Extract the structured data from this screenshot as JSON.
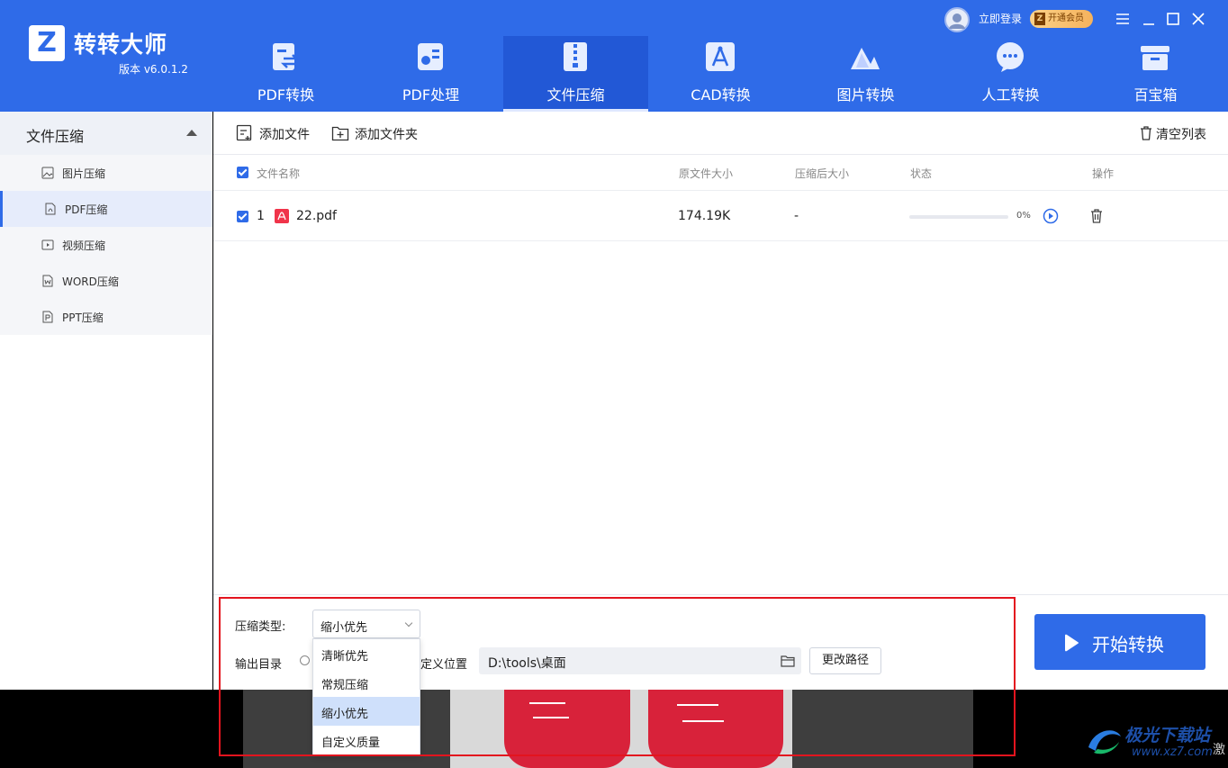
{
  "app": {
    "name": "转转大师",
    "version": "版本 v6.0.1.2",
    "logo_letter": "Z"
  },
  "nav": {
    "tabs": [
      {
        "label": "PDF转换",
        "icon": "pdf-convert-icon"
      },
      {
        "label": "PDF处理",
        "icon": "pdf-process-icon"
      },
      {
        "label": "文件压缩",
        "icon": "file-compress-icon",
        "active": true
      },
      {
        "label": "CAD转换",
        "icon": "cad-icon"
      },
      {
        "label": "图片转换",
        "icon": "image-convert-icon"
      },
      {
        "label": "人工转换",
        "icon": "manual-convert-icon"
      },
      {
        "label": "百宝箱",
        "icon": "toolbox-icon"
      }
    ]
  },
  "account": {
    "login": "立即登录",
    "vip": "开通会员",
    "vip_mark": "Z"
  },
  "sidebar": {
    "title": "文件压缩",
    "items": [
      {
        "label": "图片压缩",
        "icon": "image-icon"
      },
      {
        "label": "PDF压缩",
        "icon": "pdf-icon",
        "active": true
      },
      {
        "label": "视频压缩",
        "icon": "video-icon"
      },
      {
        "label": "WORD压缩",
        "icon": "word-icon"
      },
      {
        "label": "PPT压缩",
        "icon": "ppt-icon"
      }
    ]
  },
  "toolbar": {
    "add_file": "添加文件",
    "add_folder": "添加文件夹",
    "clear_list": "清空列表"
  },
  "table": {
    "headers": {
      "name": "文件名称",
      "original_size": "原文件大小",
      "compressed_size": "压缩后大小",
      "status": "状态",
      "actions": "操作"
    },
    "rows": [
      {
        "index": "1",
        "name": "22.pdf",
        "original_size": "174.19K",
        "compressed_size": "-",
        "progress": 0,
        "progress_text": "0%"
      }
    ]
  },
  "settings": {
    "compress_type_label": "压缩类型:",
    "compress_type_value": "缩小优先",
    "output_label": "输出目录",
    "custom_location_label": "定义位置",
    "output_path": "D:\\tools\\桌面",
    "change_path": "更改路径",
    "start_button": "开始转换"
  },
  "dropdown": {
    "options": [
      "清晰优先",
      "常规压缩",
      "缩小优先",
      "自定义质量"
    ],
    "selected": "缩小优先"
  },
  "watermark": {
    "title": "极光下载站",
    "url": "www.xz7.com",
    "side_text": "激"
  },
  "colors": {
    "brand": "#2f6be8",
    "highlight_box": "#e3141e"
  }
}
